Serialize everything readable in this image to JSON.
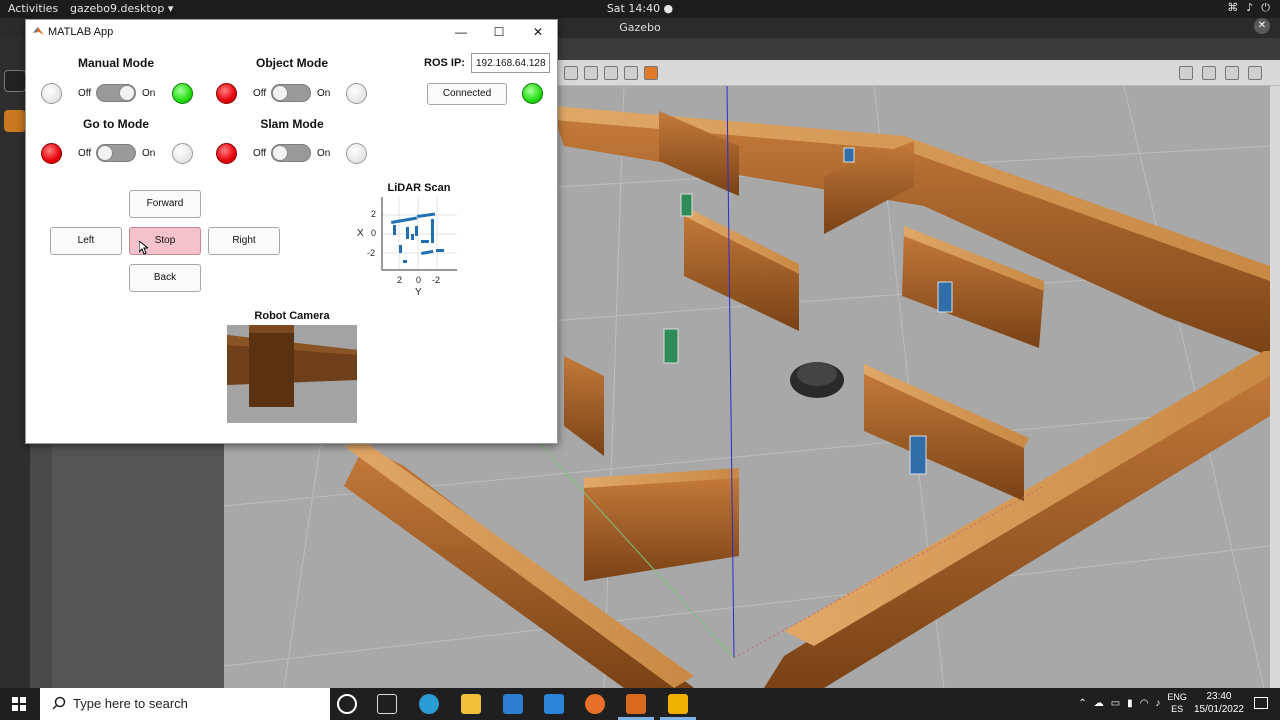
{
  "topbar": {
    "activities": "Activities",
    "app_menu": "gazebo9.desktop ▾",
    "clock": "Sat 14:40 ●",
    "tray_icons": [
      "network-icon",
      "volume-icon",
      "power-icon"
    ]
  },
  "gazebo": {
    "window_title": "Gazebo"
  },
  "matlab": {
    "title": "MATLAB App",
    "modes": {
      "manual": {
        "title": "Manual Mode",
        "off": "Off",
        "on": "On"
      },
      "object": {
        "title": "Object Mode",
        "off": "Off",
        "on": "On"
      },
      "goto": {
        "title": "Go to Mode",
        "off": "Off",
        "on": "On"
      },
      "slam": {
        "title": "Slam Mode",
        "off": "Off",
        "on": "On"
      }
    },
    "ros": {
      "label": "ROS IP:",
      "ip": "192.168.64.128",
      "connect_button": "Connected"
    },
    "buttons": {
      "forward": "Forward",
      "left": "Left",
      "stop": "Stop",
      "right": "Right",
      "back": "Back"
    },
    "lidar": {
      "title": "LiDAR Scan",
      "x_ticks": [
        "2",
        "0",
        "-2"
      ],
      "y_ticks": [
        "2",
        "0",
        "-2"
      ],
      "xlabel": "Y",
      "ylabel": "X"
    },
    "camera": {
      "title": "Robot Camera"
    },
    "colors": {
      "lamp_red": "#e8000b",
      "lamp_green": "#22dd11",
      "stop_pressed": "#f4c2cb",
      "scan_points": "#1f6fb2"
    }
  },
  "taskbar": {
    "search_placeholder": "Type here to search",
    "lang_top": "ENG",
    "lang_bottom": "ES",
    "time": "23:40",
    "date": "15/01/2022"
  }
}
